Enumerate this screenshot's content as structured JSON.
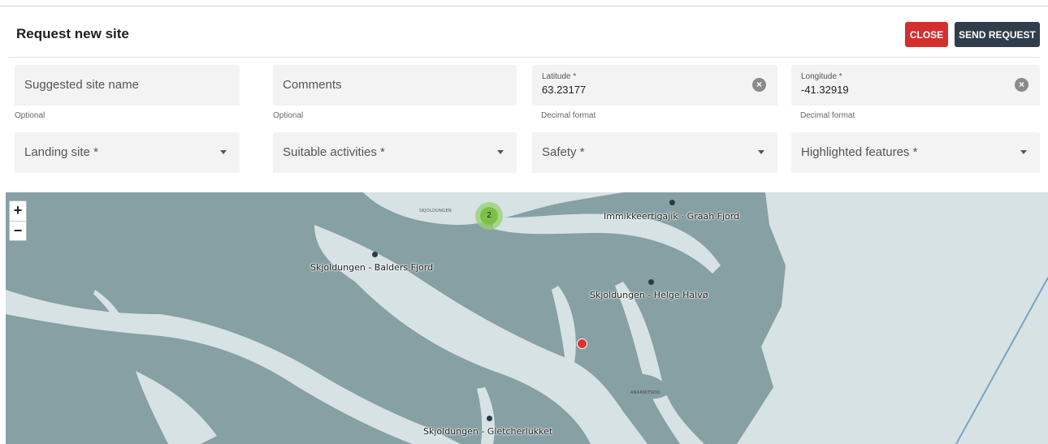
{
  "header": {
    "title": "Request new site",
    "close_label": "CLOSE",
    "send_label": "SEND REQUEST"
  },
  "form": {
    "site_name": {
      "placeholder": "Suggested site name",
      "helper": "Optional"
    },
    "comments": {
      "placeholder": "Comments",
      "helper": "Optional"
    },
    "latitude": {
      "label": "Latitude *",
      "value": "63.23177",
      "helper": "Decimal format"
    },
    "longitude": {
      "label": "Longitude *",
      "value": "-41.32919",
      "helper": "Decimal format"
    },
    "landing_site": {
      "placeholder": "Landing site *"
    },
    "suitable_activities": {
      "placeholder": "Suitable activities *"
    },
    "safety": {
      "placeholder": "Safety *"
    },
    "highlighted_features": {
      "placeholder": "Highlighted features *"
    }
  },
  "map": {
    "zoom_in": "+",
    "zoom_out": "−",
    "cluster_count": "2",
    "cluster_label": "SKJOLDUNGEN",
    "sites": [
      "Immikkeertigajik - Graah Fjord",
      "Skjoldungen - Balders Fjord",
      "Skjoldungen - Helge Halvø",
      "Skjoldungen - Gletcherlukket"
    ],
    "place_label": "ANARNITSOQ",
    "colors": {
      "land": "#86a0a4",
      "water": "#d7e2e4",
      "marker": "#2d3a45",
      "selected": "#e03232",
      "cluster": "#7cc04a"
    }
  },
  "colors": {
    "close": "#d32f2f",
    "send": "#2f3e4a",
    "field_bg": "#f3f3f3"
  }
}
